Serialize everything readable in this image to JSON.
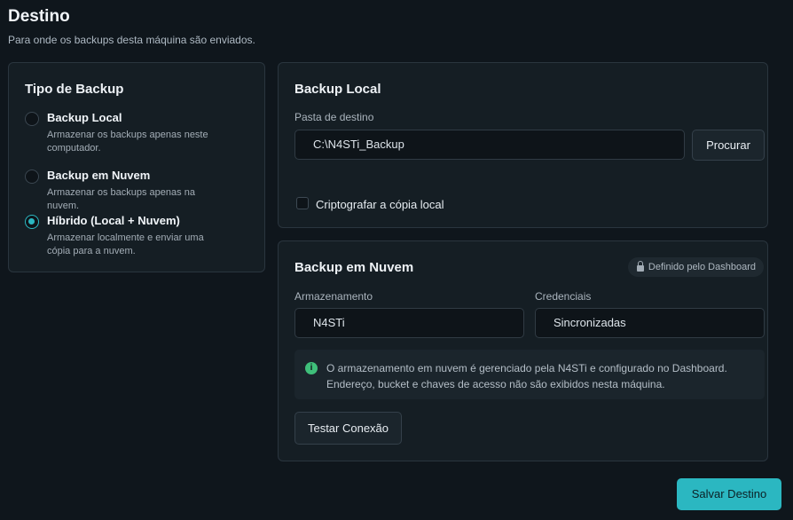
{
  "header": {
    "title": "Destino",
    "subtitle": "Para onde os backups desta máquina são enviados."
  },
  "backup_type": {
    "title": "Tipo de Backup",
    "options": [
      {
        "label": "Backup Local",
        "description": "Armazenar os backups apenas neste computador.",
        "selected": false
      },
      {
        "label": "Backup em Nuvem",
        "description": "Armazenar os backups apenas na nuvem.",
        "selected": false
      },
      {
        "label": "Híbrido (Local + Nuvem)",
        "description": "Armazenar localmente e enviar uma cópia para a nuvem.",
        "selected": true
      }
    ]
  },
  "local": {
    "title": "Backup Local",
    "folder_label": "Pasta de destino",
    "folder_value": "C:\\N4STi_Backup",
    "browse_label": "Procurar",
    "encrypt_label": "Criptografar a cópia local",
    "encrypt_checked": false
  },
  "cloud": {
    "title": "Backup em Nuvem",
    "badge": "Definido pelo Dashboard",
    "storage_label": "Armazenamento",
    "storage_value": "N4STi",
    "credentials_label": "Credenciais",
    "credentials_value": "Sincronizadas",
    "info_text": "O armazenamento em nuvem é gerenciado pela N4STi e configurado no Dashboard. Endereço, bucket e chaves de acesso não são exibidos nesta máquina.",
    "test_label": "Testar Conexão"
  },
  "actions": {
    "save_label": "Salvar Destino"
  },
  "colors": {
    "accent": "#2bb7c1",
    "info": "#3fbf7a",
    "background": "#0f161c",
    "card": "#151e24"
  }
}
